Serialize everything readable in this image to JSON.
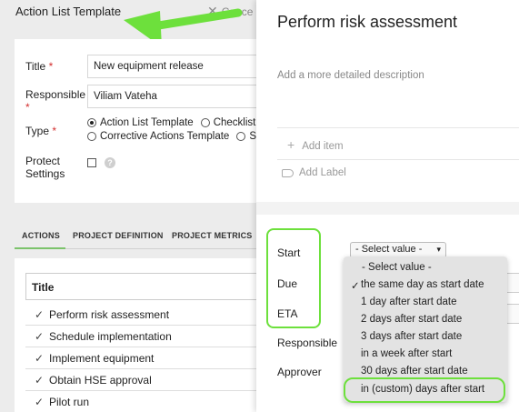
{
  "header": {
    "title": "Action List Template",
    "cancel_label": "Cance"
  },
  "form": {
    "title_label": "Title",
    "title_value": "New equipment release",
    "responsible_label": "Responsible",
    "responsible_value": "Viliam Vateha",
    "type_label": "Type",
    "type_options": [
      "Action List Template",
      "Checklist",
      "Corrective Actions Template",
      "St"
    ],
    "type_selected": "Action List Template",
    "protect_label_1": "Protect",
    "protect_label_2": "Settings",
    "required_mark": "*",
    "help_glyph": "?"
  },
  "tabs": [
    "ACTIONS",
    "PROJECT DEFINITION",
    "PROJECT METRICS"
  ],
  "list": {
    "header": "Title",
    "rows": [
      "Perform risk assessment",
      "Schedule implementation",
      "Implement equipment",
      "Obtain HSE approval",
      "Pilot run"
    ]
  },
  "panel": {
    "title": "Perform risk assessment",
    "description_placeholder": "Add a more detailed description",
    "add_item": "Add item",
    "add_label": "Add Label",
    "fields": {
      "start": "Start",
      "due": "Due",
      "eta": "ETA",
      "responsible": "Responsible",
      "approver": "Approver"
    },
    "select_value": "- Select value -",
    "dropdown_options": [
      "- Select value -",
      "the same day as start date",
      "1 day after start date",
      "2 days after start date",
      "3 days after start date",
      "in a week after start",
      "30 days after start date",
      "in (custom) days after start"
    ],
    "dropdown_checked": "the same day as start date"
  },
  "colors": {
    "highlight": "#6de03c",
    "required": "#d32f2f",
    "tab_active": "#7cc36b"
  },
  "icons": {
    "close": "close-icon",
    "check": "check-icon",
    "plus": "plus-icon",
    "tag": "tag-icon",
    "arrow": "annotation-arrow-icon"
  }
}
